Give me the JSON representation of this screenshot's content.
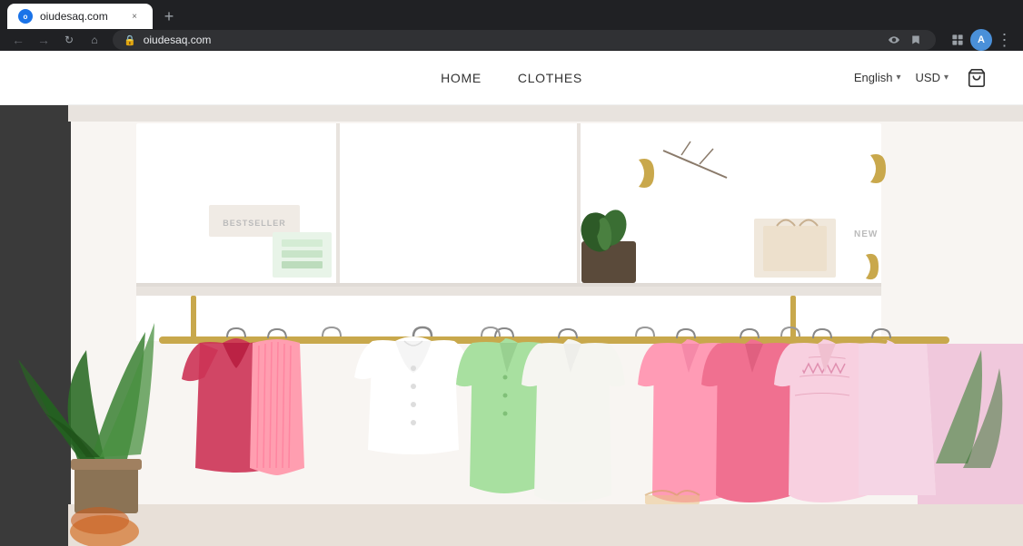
{
  "browser": {
    "tab": {
      "favicon_letter": "o",
      "title": "oiudesaq.com",
      "close_label": "×"
    },
    "new_tab_label": "+",
    "nav": {
      "back_label": "←",
      "forward_label": "→",
      "reload_label": "↻",
      "home_label": "⌂"
    },
    "address": "oiudesaq.com",
    "toolbar": {
      "eye_icon_label": "👁",
      "star_icon_label": "☆",
      "extensions_icon_label": "🧩",
      "people_icon_label": "👤",
      "profile_letter": "A",
      "menu_label": "⋮"
    }
  },
  "website": {
    "nav": {
      "home_label": "HOME",
      "clothes_label": "CLOTHES",
      "language_label": "English",
      "language_chevron": "▾",
      "currency_label": "USD",
      "currency_chevron": "▾",
      "cart_icon": "🛒"
    },
    "hero": {
      "alt": "Clothing store with hanging garments on racks"
    }
  },
  "colors": {
    "browser_bg": "#202124",
    "tab_bg": "#ffffff",
    "address_bar_bg": "#303134",
    "navbar_bg": "#ffffff",
    "hero_bg": "#f5f0eb"
  }
}
